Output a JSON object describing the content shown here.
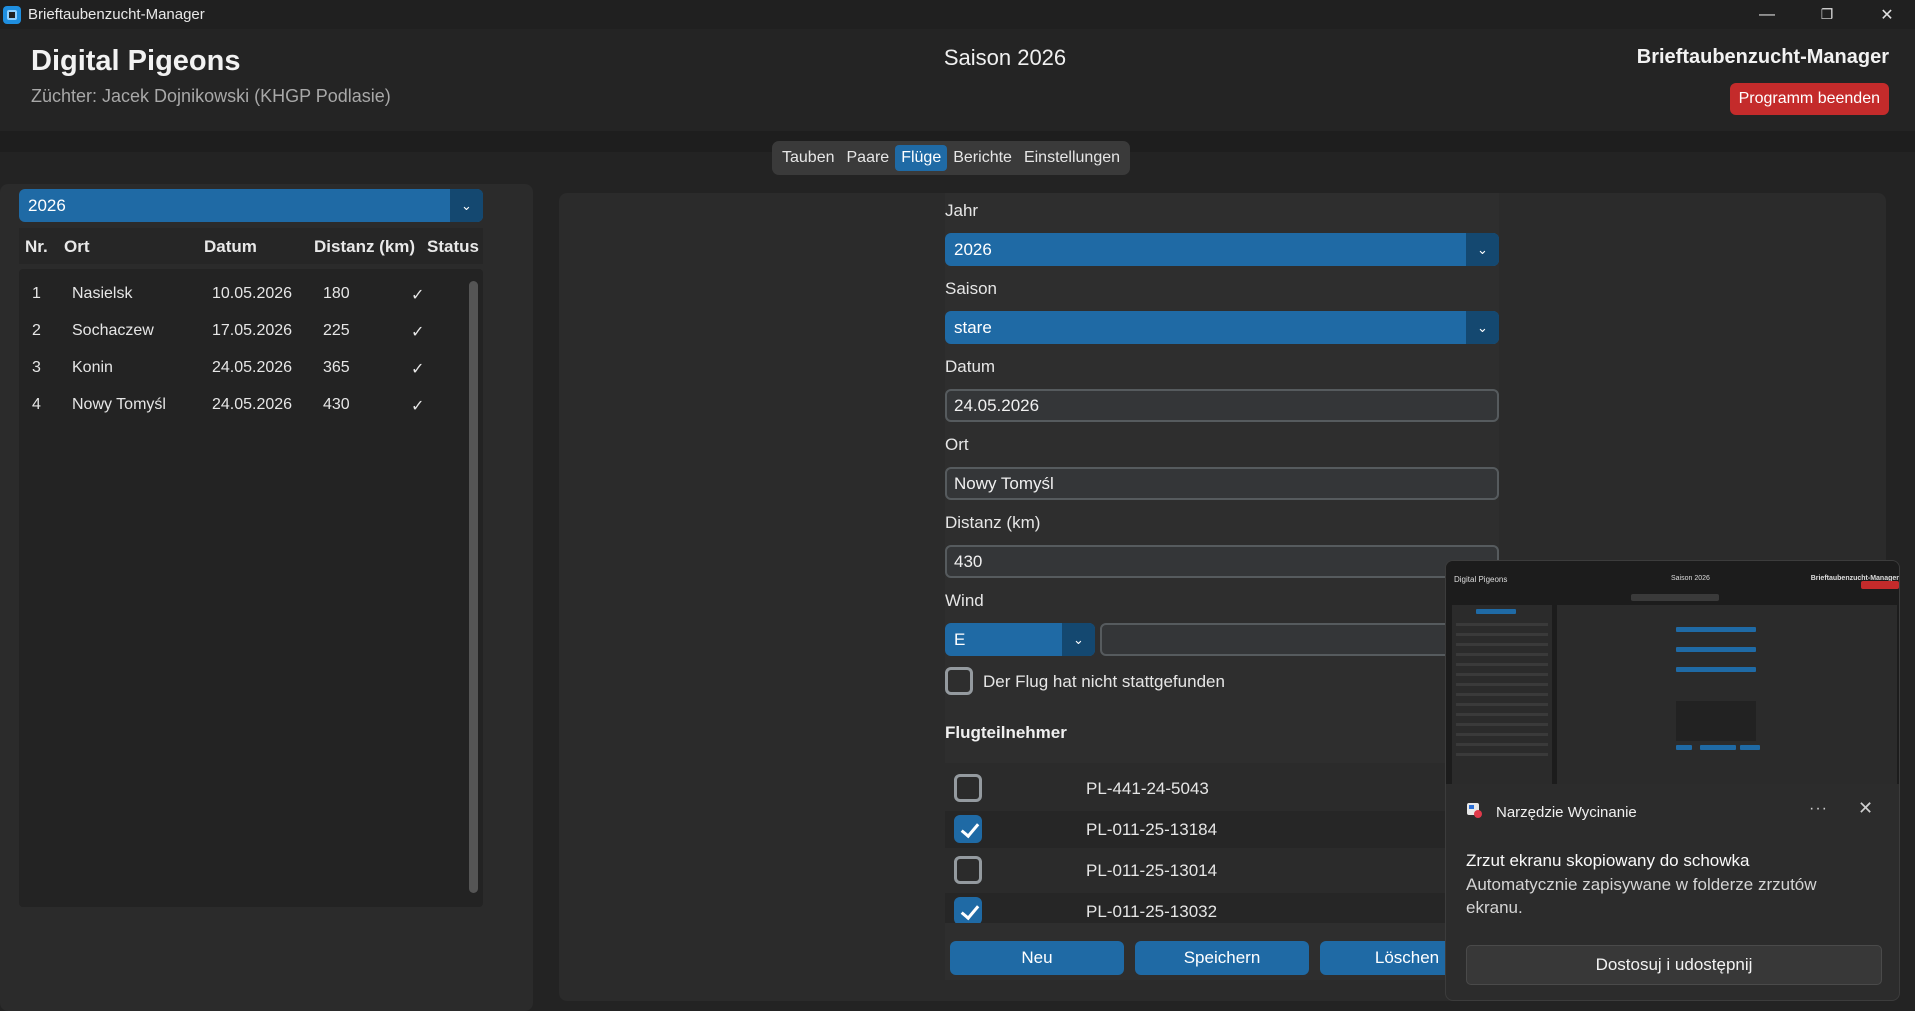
{
  "window": {
    "title": "Brieftaubenzucht-Manager",
    "controls": {
      "minimize": "—",
      "restore": "❐",
      "close": "✕"
    }
  },
  "header": {
    "app_title": "Digital Pigeons",
    "breeder": "Züchter: Jacek Dojnikowski (KHGP Podlasie)",
    "season": "Saison 2026",
    "brand": "Brieftaubenzucht-Manager",
    "quit_label": "Programm beenden"
  },
  "colors": {
    "accent": "#1f6aa5",
    "accent_dark": "#144870",
    "danger": "#c42b2b",
    "background": "#1e1e1e"
  },
  "tabs": [
    {
      "label": "Tauben",
      "active": false
    },
    {
      "label": "Paare",
      "active": false
    },
    {
      "label": "Flüge",
      "active": true
    },
    {
      "label": "Berichte",
      "active": false
    },
    {
      "label": "Einstellungen",
      "active": false
    }
  ],
  "flight_list": {
    "year_filter": "2026",
    "columns": [
      "Nr.",
      "Ort",
      "Datum",
      "Distanz (km)",
      "Status"
    ],
    "rows": [
      {
        "nr": "1",
        "ort": "Nasielsk",
        "datum": "10.05.2026",
        "distanz": "180",
        "status": "✓"
      },
      {
        "nr": "2",
        "ort": "Sochaczew",
        "datum": "17.05.2026",
        "distanz": "225",
        "status": "✓"
      },
      {
        "nr": "3",
        "ort": "Konin",
        "datum": "24.05.2026",
        "distanz": "365",
        "status": "✓"
      },
      {
        "nr": "4",
        "ort": "Nowy Tomyśl",
        "datum": "24.05.2026",
        "distanz": "430",
        "status": "✓"
      }
    ]
  },
  "form": {
    "year_label": "Jahr",
    "year_value": "2026",
    "season_label": "Saison",
    "season_value": "stare",
    "date_label": "Datum",
    "date_value": "24.05.2026",
    "place_label": "Ort",
    "place_value": "Nowy Tomyśl",
    "distance_label": "Distanz (km)",
    "distance_value": "430",
    "wind_label": "Wind",
    "wind_value": "E",
    "wind_extra_value": "",
    "not_held_label": "Der Flug hat nicht stattgefunden",
    "not_held_checked": false,
    "participants_title": "Flugteilnehmer",
    "participants": [
      {
        "ring": "PL-441-24-5043",
        "checked": false
      },
      {
        "ring": "PL-011-25-13184",
        "checked": true
      },
      {
        "ring": "PL-011-25-13014",
        "checked": false
      },
      {
        "ring": "PL-011-25-13032",
        "checked": true
      }
    ],
    "buttons": {
      "new": "Neu",
      "save": "Speichern",
      "delete": "Löschen"
    }
  },
  "notification": {
    "app_name": "Narzędzie Wycinanie",
    "more": "···",
    "close": "✕",
    "title": "Zrzut ekranu skopiowany do schowka",
    "body": "Automatycznie zapisywane w folderze zrzutów ekranu.",
    "action": "Dostosuj i udostępnij",
    "thumbnail": {
      "app_title": "Digital Pigeons",
      "season": "Saison 2026",
      "brand": "Brieftaubenzucht-Manager"
    }
  }
}
